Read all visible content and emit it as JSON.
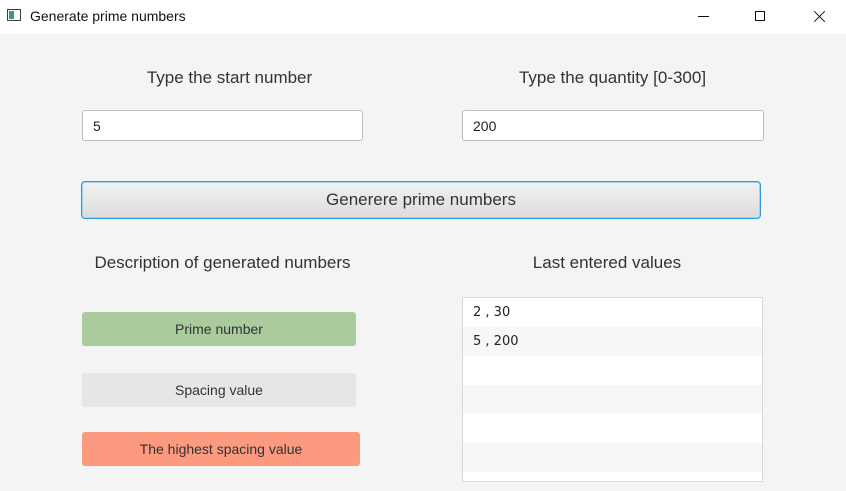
{
  "window": {
    "title": "Generate prime numbers",
    "icon": "app-window-icon",
    "controls": [
      "minimize-icon",
      "maximize-icon",
      "close-icon"
    ]
  },
  "start": {
    "label": "Type the start number",
    "value": "5"
  },
  "quantity": {
    "label": "Type the quantity [0-300]",
    "value": "200"
  },
  "generate_button": {
    "label": "Generere prime numbers"
  },
  "description": {
    "heading": "Description of generated numbers",
    "items": [
      {
        "label": "Prime number",
        "color": "#aacb9d"
      },
      {
        "label": "Spacing value",
        "color": "#e6e6e6"
      },
      {
        "label": "The highest spacing value",
        "color": "#fc9a80"
      }
    ]
  },
  "history": {
    "heading": "Last entered values",
    "entries": [
      "2 , 30",
      "5 , 200",
      "",
      "",
      "",
      "",
      ""
    ]
  },
  "colors": {
    "focus_border": "#2b9be0",
    "background": "#f4f4f4"
  }
}
